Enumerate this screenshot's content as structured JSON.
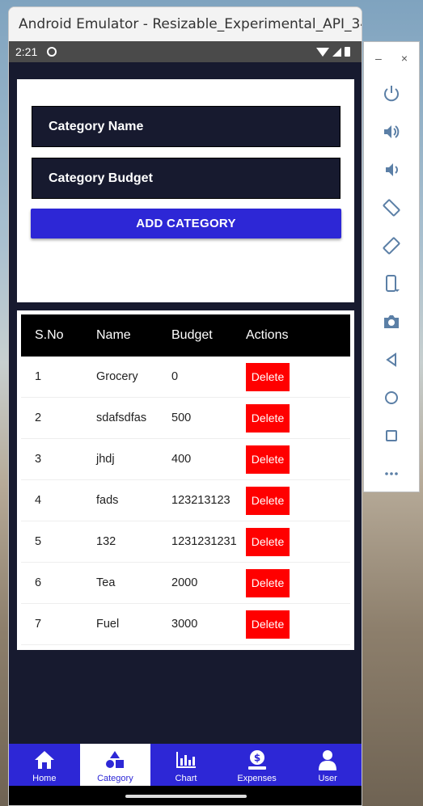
{
  "window": {
    "title": "Android Emulator - Resizable_Experimental_API_34:..."
  },
  "status_bar": {
    "time": "2:21"
  },
  "form": {
    "category_name_placeholder": "Category Name",
    "category_budget_placeholder": "Category Budget",
    "add_button": "ADD CATEGORY"
  },
  "table": {
    "headers": {
      "sno": "S.No",
      "name": "Name",
      "budget": "Budget",
      "actions": "Actions"
    },
    "rows": [
      {
        "sno": "1",
        "name": "Grocery",
        "budget": "0",
        "action": "Delete"
      },
      {
        "sno": "2",
        "name": "sdafsdfas",
        "budget": "500",
        "action": "Delete"
      },
      {
        "sno": "3",
        "name": "jhdj",
        "budget": "400",
        "action": "Delete"
      },
      {
        "sno": "4",
        "name": "fads",
        "budget": "123213123",
        "action": "Delete"
      },
      {
        "sno": "5",
        "name": "132",
        "budget": "1231231231",
        "action": "Delete"
      },
      {
        "sno": "6",
        "name": "Tea",
        "budget": "2000",
        "action": "Delete"
      },
      {
        "sno": "7",
        "name": "Fuel",
        "budget": "3000",
        "action": "Delete"
      }
    ]
  },
  "nav": {
    "items": [
      {
        "label": "Home",
        "icon": "home-icon"
      },
      {
        "label": "Category",
        "icon": "category-icon",
        "active": true
      },
      {
        "label": "Chart",
        "icon": "chart-icon"
      },
      {
        "label": "Expenses",
        "icon": "expenses-icon"
      },
      {
        "label": "User",
        "icon": "user-icon"
      }
    ]
  },
  "toolbar": {
    "minimize": "–",
    "close": "×",
    "buttons": [
      "power-icon",
      "volume-up-icon",
      "volume-down-icon",
      "rotate-left-icon",
      "rotate-right-icon",
      "fold-icon",
      "camera-icon",
      "back-icon",
      "home-circle-icon",
      "overview-icon",
      "more-icon"
    ]
  },
  "colors": {
    "accent": "#2d27d6",
    "screen_bg": "#171a2f",
    "delete": "#ff0000"
  }
}
